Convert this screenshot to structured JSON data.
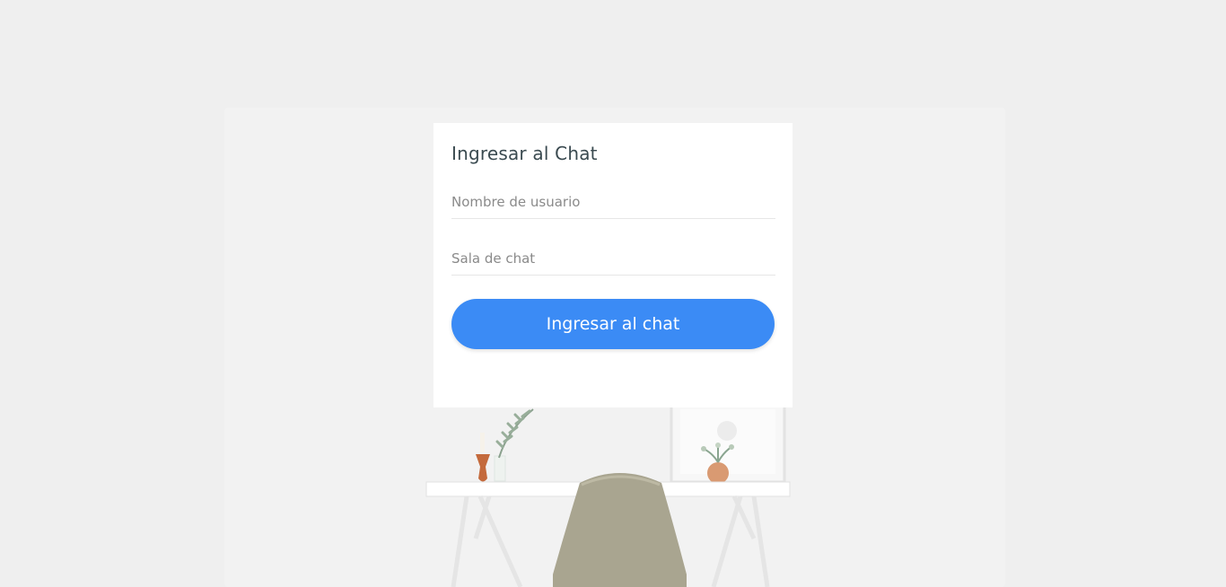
{
  "login": {
    "title": "Ingresar al Chat",
    "username_placeholder": "Nombre de usuario",
    "room_placeholder": "Sala de chat",
    "submit_label": "Ingresar al chat"
  },
  "colors": {
    "background": "#efefef",
    "card": "#ffffff",
    "button": "#3b8bf5",
    "button_text": "#ffffff",
    "title_text": "#3a4a50"
  }
}
